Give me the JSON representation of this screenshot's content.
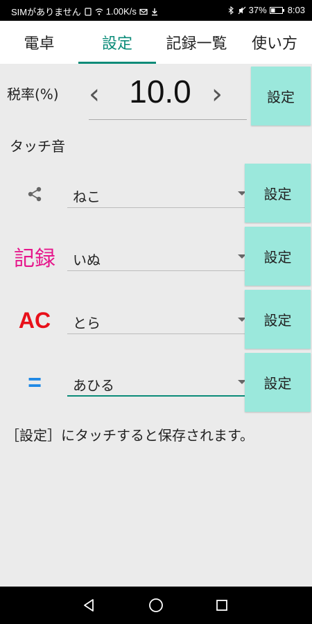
{
  "status_bar": {
    "carrier": "SIMがありません",
    "speed": "1.00K/s",
    "battery": "37%",
    "time": "8:03"
  },
  "tabs": [
    {
      "label": "電卓",
      "active": false
    },
    {
      "label": "設定",
      "active": true
    },
    {
      "label": "記録一覧",
      "active": false
    },
    {
      "label": "使い方",
      "active": false
    }
  ],
  "tax": {
    "label": "税率(%)",
    "value": "10.0",
    "decrement": "‹",
    "increment": "›",
    "button": "設定"
  },
  "touch_sound": {
    "label": "タッチ音",
    "rows": [
      {
        "icon": "share-icon",
        "icon_text": "",
        "icon_color": "#666666",
        "value": "ねこ",
        "button": "設定"
      },
      {
        "icon": "record-icon",
        "icon_text": "記録",
        "icon_color": "#e6168b",
        "value": "いぬ",
        "button": "設定"
      },
      {
        "icon": "ac-icon",
        "icon_text": "AC",
        "icon_color": "#e8101a",
        "value": "とら",
        "button": "設定"
      },
      {
        "icon": "equals-icon",
        "icon_text": "=",
        "icon_color": "#1e88e5",
        "value": "あひる",
        "button": "設定"
      }
    ]
  },
  "hint": "［設定］にタッチすると保存されます。",
  "colors": {
    "accent": "#0a8b78",
    "button": "#9be8dc",
    "background": "#ebebeb"
  }
}
